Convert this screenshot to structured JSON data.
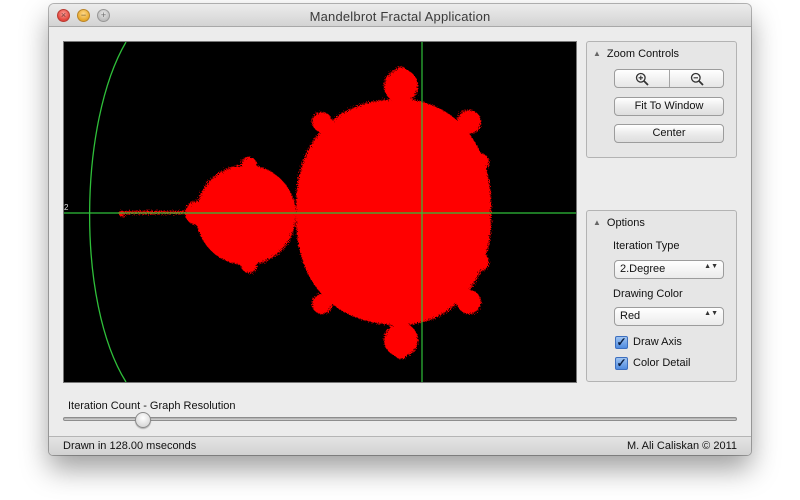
{
  "window": {
    "title": "Mandelbrot Fractal Application",
    "close_glyph": "×",
    "minimize_glyph": "−",
    "zoom_glyph": "+"
  },
  "canvas": {
    "axis_label": "2",
    "fractal_color": "#ff0000",
    "axis_color": "#2fbf3a",
    "background_color": "#000000"
  },
  "zoom_controls": {
    "title": "Zoom Controls",
    "zoom_in_icon": "zoom-in-icon",
    "zoom_out_icon": "zoom-out-icon",
    "fit_label": "Fit To Window",
    "center_label": "Center"
  },
  "options": {
    "title": "Options",
    "iteration_type_label": "Iteration Type",
    "iteration_type_value": "2.Degree",
    "drawing_color_label": "Drawing Color",
    "drawing_color_value": "Red",
    "draw_axis_label": "Draw Axis",
    "draw_axis_checked": true,
    "color_detail_label": "Color Detail",
    "color_detail_checked": true,
    "check_glyph": "✓",
    "select_arrows": "▲▼"
  },
  "slider": {
    "label": "Iteration Count - Graph Resolution",
    "position_fraction": 0.11
  },
  "status": {
    "left": "Drawn in 128.00 mseconds",
    "right": "M. Ali Caliskan © 2011"
  }
}
